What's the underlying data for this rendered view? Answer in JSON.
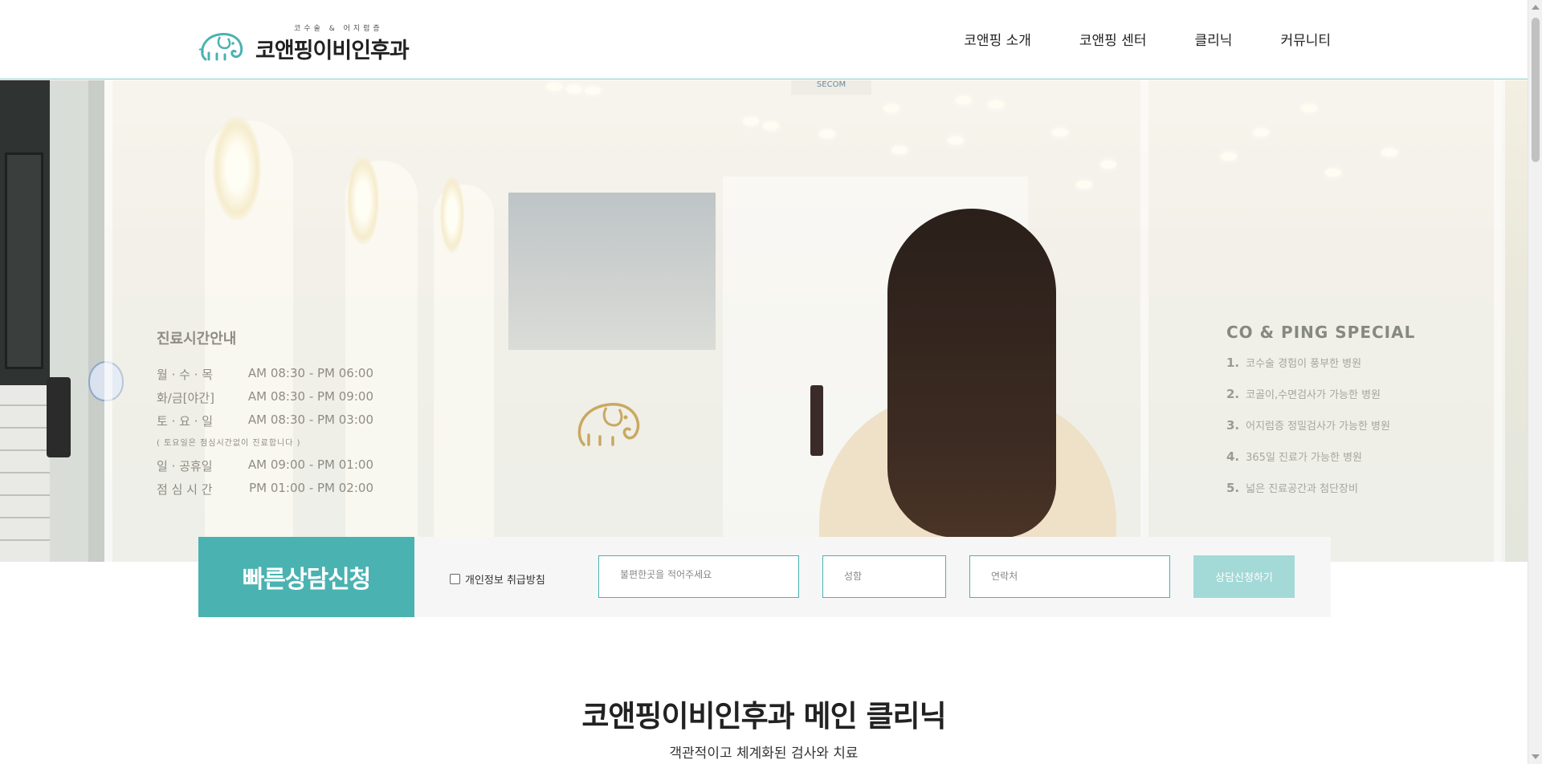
{
  "header": {
    "logo_sub": "코수술 & 어지럼증",
    "logo_main": "코앤핑이비인후과",
    "nav": [
      "코앤핑 소개",
      "코앤핑 센터",
      "클리닉",
      "커뮤니티"
    ]
  },
  "hero": {
    "ceiling_sign": "SECOM",
    "hours": {
      "title": "진료시간안내",
      "rows": [
        {
          "day": "월 · 수 · 목",
          "time": "AM 08:30 - PM 06:00"
        },
        {
          "day": "화/금[야간]",
          "time": "AM 08:30 - PM 09:00"
        },
        {
          "day": "토 · 요 · 일",
          "time": "AM 08:30 - PM 03:00"
        }
      ],
      "note": "( 토요일은 점심시간없이 진료합니다 )",
      "rows2": [
        {
          "day": "일 · 공휴일",
          "time": "AM 09:00 - PM 01:00"
        },
        {
          "day": "점 심 시 간",
          "time": "PM 01:00 - PM 02:00"
        }
      ]
    },
    "special": {
      "title": "CO & PING SPECIAL",
      "items": [
        {
          "num": "1.",
          "text": "코수술 경험이 풍부한 병원"
        },
        {
          "num": "2.",
          "text": "코골이,수면검사가 가능한 병원"
        },
        {
          "num": "3.",
          "text": "어지럼증 정밀검사가 가능한 병원"
        },
        {
          "num": "4.",
          "text": "365일 진료가 가능한 병원"
        },
        {
          "num": "5.",
          "text": "넓은 진료공간과 첨단장비"
        }
      ]
    }
  },
  "consult": {
    "title": "빠른상담신청",
    "privacy_label": "개인정보 취급방침",
    "privacy_checked": false,
    "symptom_placeholder": "불편한곳을 적어주세요",
    "name_placeholder": "성함",
    "phone_placeholder": "연락처",
    "submit_label": "상담신청하기"
  },
  "main": {
    "title": "코앤핑이비인후과 메인 클리닉",
    "subtitle": "객관적이고 체계화된 검사와 치료"
  },
  "colors": {
    "accent": "#4ab2b1",
    "accent_light": "#a3d9d7",
    "header_border": "#7fcfcc"
  }
}
